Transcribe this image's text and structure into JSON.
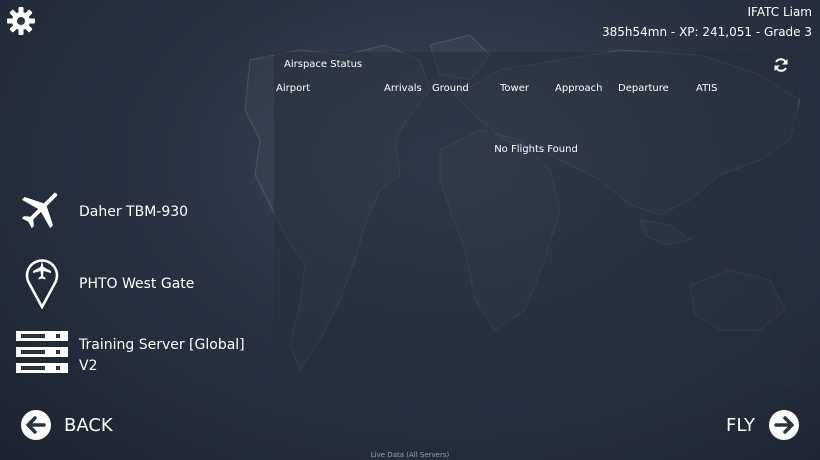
{
  "user": {
    "name": "IFATC Liam",
    "stats": "385h54mn - XP: 241,051 - Grade 3"
  },
  "panel": {
    "title": "Airspace Status",
    "columns": [
      "Airport",
      "Arrivals",
      "Ground",
      "Tower",
      "Approach",
      "Departure",
      "ATIS"
    ],
    "empty_message": "No Flights Found"
  },
  "selections": {
    "aircraft": "Daher TBM-930",
    "location": "PHTO West Gate",
    "server_line1": "Training Server [Global]",
    "server_line2": "V2"
  },
  "nav": {
    "back_label": "BACK",
    "fly_label": "FLY"
  },
  "footer": {
    "text": "Live Data (All Servers)"
  },
  "icons": [
    "gear-icon",
    "refresh-icon",
    "airplane-icon",
    "location-pin-icon",
    "server-icon",
    "arrow-left-icon",
    "arrow-right-icon"
  ]
}
